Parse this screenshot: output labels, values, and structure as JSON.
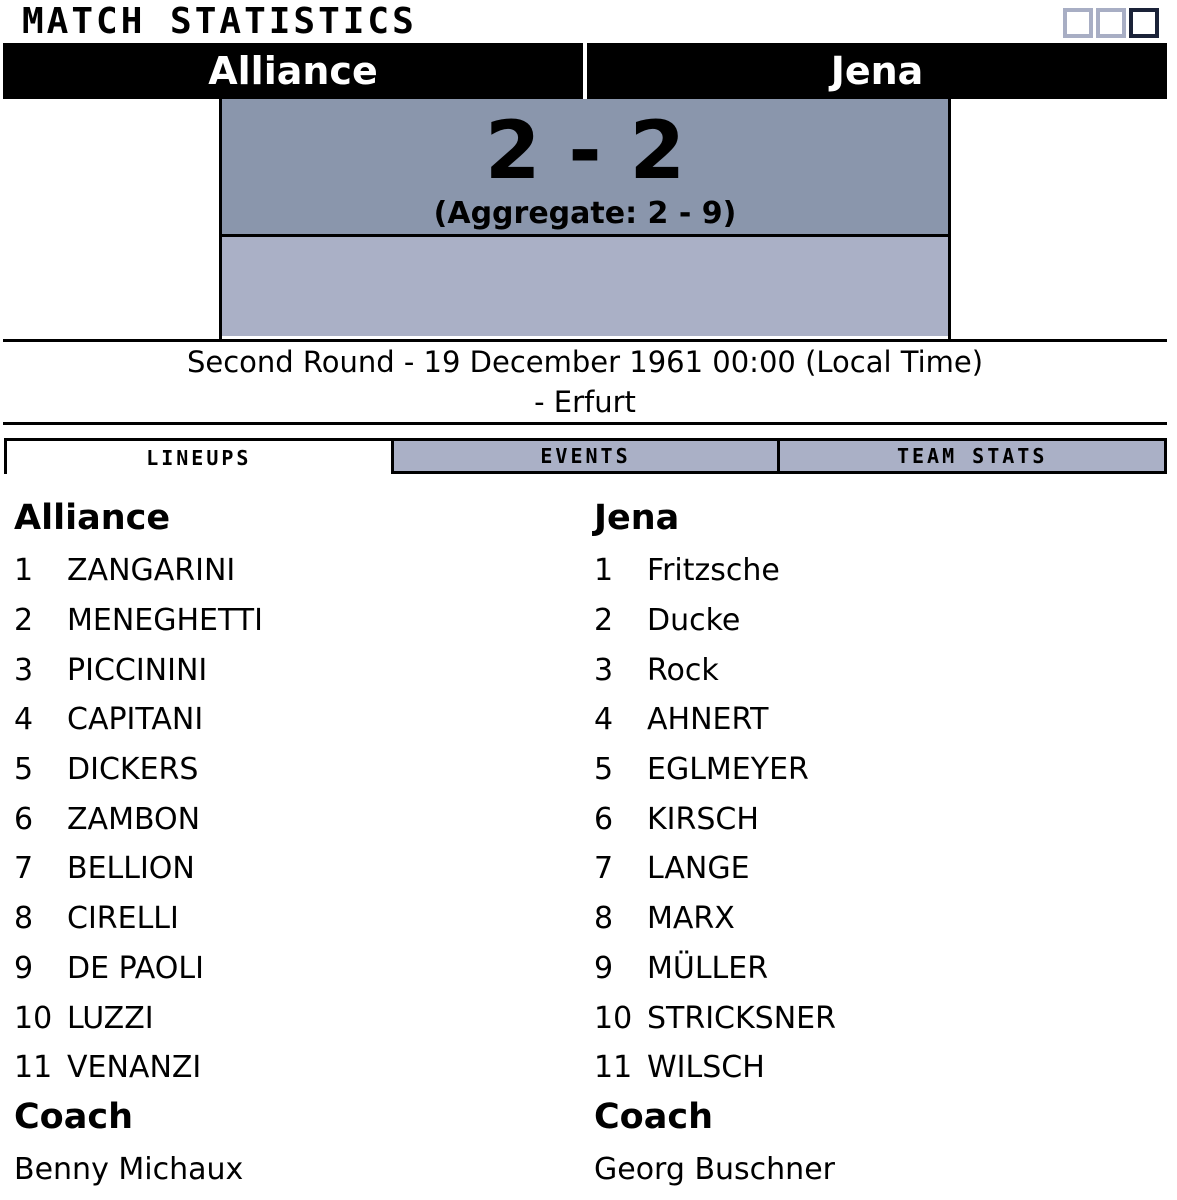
{
  "header": {
    "title": "MATCH STATISTICS",
    "window_controls": [
      "minimize-icon",
      "restore-icon",
      "maximize-icon"
    ]
  },
  "match": {
    "home_team": "Alliance",
    "away_team": "Jena",
    "score": "2 - 2",
    "aggregate": "(Aggregate: 2 - 9)",
    "info_line1": "Second Round - 19 December 1961 00:00 (Local Time)",
    "info_line2": "- Erfurt"
  },
  "tabs": [
    {
      "label": "LINEUPS",
      "selected": true
    },
    {
      "label": "EVENTS",
      "selected": false
    },
    {
      "label": "TEAM STATS",
      "selected": false
    }
  ],
  "lineups": {
    "home": {
      "team": "Alliance",
      "players": [
        {
          "num": "1",
          "name": "ZANGARINI"
        },
        {
          "num": "2",
          "name": "MENEGHETTI"
        },
        {
          "num": "3",
          "name": "PICCININI"
        },
        {
          "num": "4",
          "name": "CAPITANI"
        },
        {
          "num": "5",
          "name": "DICKERS"
        },
        {
          "num": "6",
          "name": "ZAMBON"
        },
        {
          "num": "7",
          "name": "BELLION"
        },
        {
          "num": "8",
          "name": "CIRELLI"
        },
        {
          "num": "9",
          "name": "DE PAOLI"
        },
        {
          "num": "10",
          "name": "LUZZI"
        },
        {
          "num": "11",
          "name": "VENANZI"
        }
      ],
      "coach_label": "Coach",
      "coach": "Benny Michaux"
    },
    "away": {
      "team": "Jena",
      "players": [
        {
          "num": "1",
          "name": "Fritzsche"
        },
        {
          "num": "2",
          "name": "Ducke"
        },
        {
          "num": "3",
          "name": "Rock"
        },
        {
          "num": "4",
          "name": "AHNERT"
        },
        {
          "num": "5",
          "name": "EGLMEYER"
        },
        {
          "num": "6",
          "name": "KIRSCH"
        },
        {
          "num": "7",
          "name": "LANGE"
        },
        {
          "num": "8",
          "name": "MARX"
        },
        {
          "num": "9",
          "name": "MÜLLER"
        },
        {
          "num": "10",
          "name": "STRICKSNER"
        },
        {
          "num": "11",
          "name": "WILSCH"
        }
      ],
      "coach_label": "Coach",
      "coach": "Georg Buschner"
    }
  },
  "colors": {
    "score_top_bg": "#8a96ac",
    "score_bottom_bg": "#aab0c6",
    "tab_bg": "#aab0c6",
    "header_bg": "#000000"
  }
}
